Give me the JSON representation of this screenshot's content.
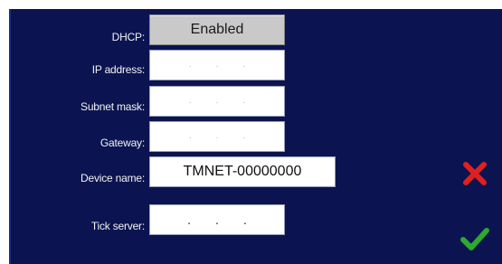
{
  "form": {
    "dhcp": {
      "label": "DHCP:",
      "value": "Enabled"
    },
    "ip_address": {
      "label": "IP address:",
      "value": ". . ."
    },
    "subnet_mask": {
      "label": "Subnet mask:",
      "value": ". . ."
    },
    "gateway": {
      "label": "Gateway:",
      "value": ". . ."
    },
    "device_name": {
      "label": "Device name:",
      "value": "TMNET-00000000"
    },
    "tick_server": {
      "label": "Tick server:",
      "value": ". . ."
    }
  },
  "actions": {
    "cancel_icon": "close-icon",
    "confirm_icon": "check-icon"
  },
  "colors": {
    "background": "#0b1450",
    "cancel": "#e02020",
    "confirm": "#2ea82e"
  }
}
